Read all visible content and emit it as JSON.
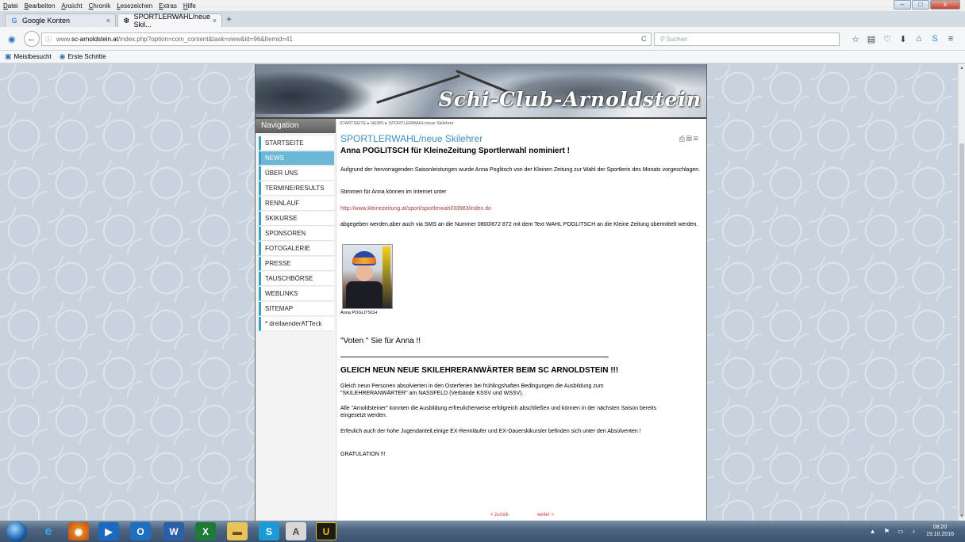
{
  "browser": {
    "menu": [
      "Datei",
      "Bearbeiten",
      "Ansicht",
      "Chronik",
      "Lesezeichen",
      "Extras",
      "Hilfe"
    ],
    "window_controls": {
      "minimize": "–",
      "maximize": "□",
      "close": "x"
    },
    "tabs": [
      {
        "label": "Google Konten",
        "icon": "google-icon",
        "active": false
      },
      {
        "label": "SPORTLERWAHL/neue Skil...",
        "icon": "snowflake-icon",
        "active": true
      }
    ],
    "new_tab": "+",
    "url": {
      "prefix": "www.",
      "host": "sc-arnoldstein.at",
      "path": "/index.php?option=com_content&task=view&id=96&Itemid=41"
    },
    "search_placeholder": "Suchen",
    "bookmarks": [
      "Meistbesucht",
      "Erste Schritte"
    ]
  },
  "site": {
    "banner_title": "Schi-Club-Arnoldstein",
    "navigation_heading": "Navigation",
    "nav_items": [
      "STARTSEITE",
      "NEWS",
      "ÜBER UNS",
      "TERMINE/RESULTS",
      "RENNLAUF",
      "SKIKURSE",
      "SPONSOREN",
      "FOTOGALERIE",
      "PRESSE",
      "TAUSCHBÖRSE",
      "WEBLINKS",
      "SITEMAP",
      "* dreilaenderATTeck"
    ],
    "active_nav": "NEWS",
    "breadcrumb": "STARTSEITE ▸ NEWS ▸ SPORTLERWAHL/neue Skilehrer",
    "article": {
      "heading": "SPORTLERWAHL/neue Skilehrer",
      "subtitle": "Anna POGLITSCH für KleineZeitung Sportlerwahl nominiert !",
      "p1": "Aufgrund der hervorragenden Saisonleistungen wurde Anna Poglitsch von der Kleinen Zeitung zur Wahl der Sportlerin des Monats vorgeschlagen.",
      "p2": "Stimmen für Anna können im Internet unter",
      "link": "http://www.kleinezeitung.at/sport/sportlerwahl/33983/index.do",
      "p3": "abgegeben werden,aber auch via SMS an die Nummer 0800/872 872 mit dem Text WAHL POGLITSCH an die Kleine Zeitung übermittelt werden.",
      "photo_caption": "Anna POGLITSCH",
      "vote": "\"Voten \" Sie für Anna !!",
      "headline2": "GLEICH NEUN NEUE SKILEHRERANWÄRTER BEIM SC ARNOLDSTEIN !!!",
      "p4": "Gleich neun Personen absolvierten in den Osterferien bei frühlingshaften Bedingungen die Ausbildung zum \"SKILEHRERANWÄRTER\" am NASSFELD (Verbände KSSV und WSSV).",
      "p5": "Alle \"Arnoldsteiner\" konnten die Ausbildung erfreulicherweise erfolgreich abschließen und können in der nächsten Saison bereits eingesetzt werden.",
      "p6": "Erfeulich auch der hohe Jugendanteil,einige EX-Rennläufer und EX-Dauerskikursler befinden sich unter den Absolventen !",
      "p7": "GRATULATION !!!"
    },
    "pager": {
      "prev": "< zurück",
      "next": "weiter >"
    }
  },
  "taskbar": {
    "apps": [
      "Internet Explorer",
      "Firefox",
      "Media Player",
      "Outlook",
      "Word",
      "Excel",
      "Explorer",
      "Skype",
      "Acrobat",
      "U"
    ],
    "time": "08:20",
    "date": "19.10.2016"
  },
  "colors": {
    "accent": "#3c8fc4",
    "nav_active": "#6ab8d6",
    "link": "#a83a3a",
    "pager": "#c0392b"
  }
}
